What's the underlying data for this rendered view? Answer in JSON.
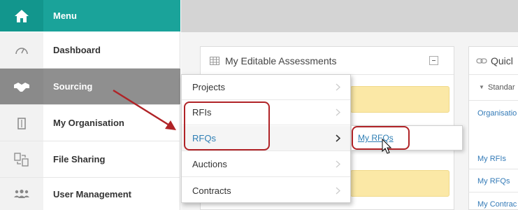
{
  "sidebar": {
    "menu_label": "Menu",
    "items": [
      {
        "label": "Dashboard",
        "icon": "gauge-icon"
      },
      {
        "label": "Sourcing",
        "icon": "handshake-icon",
        "active": true
      },
      {
        "label": "My Organisation",
        "icon": "building-icon"
      },
      {
        "label": "File Sharing",
        "icon": "file-share-icon"
      },
      {
        "label": "User Management",
        "icon": "users-icon"
      }
    ]
  },
  "main": {
    "panel_title": "My Editable Assessments",
    "quick_title": "Quicl",
    "standard_label": "Standar",
    "quick_links": [
      "Organisatio",
      "My RFIs",
      "My RFQs",
      "My Contrac"
    ]
  },
  "dropdown": {
    "items": [
      "Projects",
      "RFIs",
      "RFQs",
      "Auctions",
      "Contracts"
    ],
    "submenu_item": "My RFQs"
  },
  "colors": {
    "menu_teal": "#1aa39a",
    "active_gray": "#8f8f8f",
    "highlight_red": "#b02327",
    "link_blue": "#2f7fb5"
  }
}
